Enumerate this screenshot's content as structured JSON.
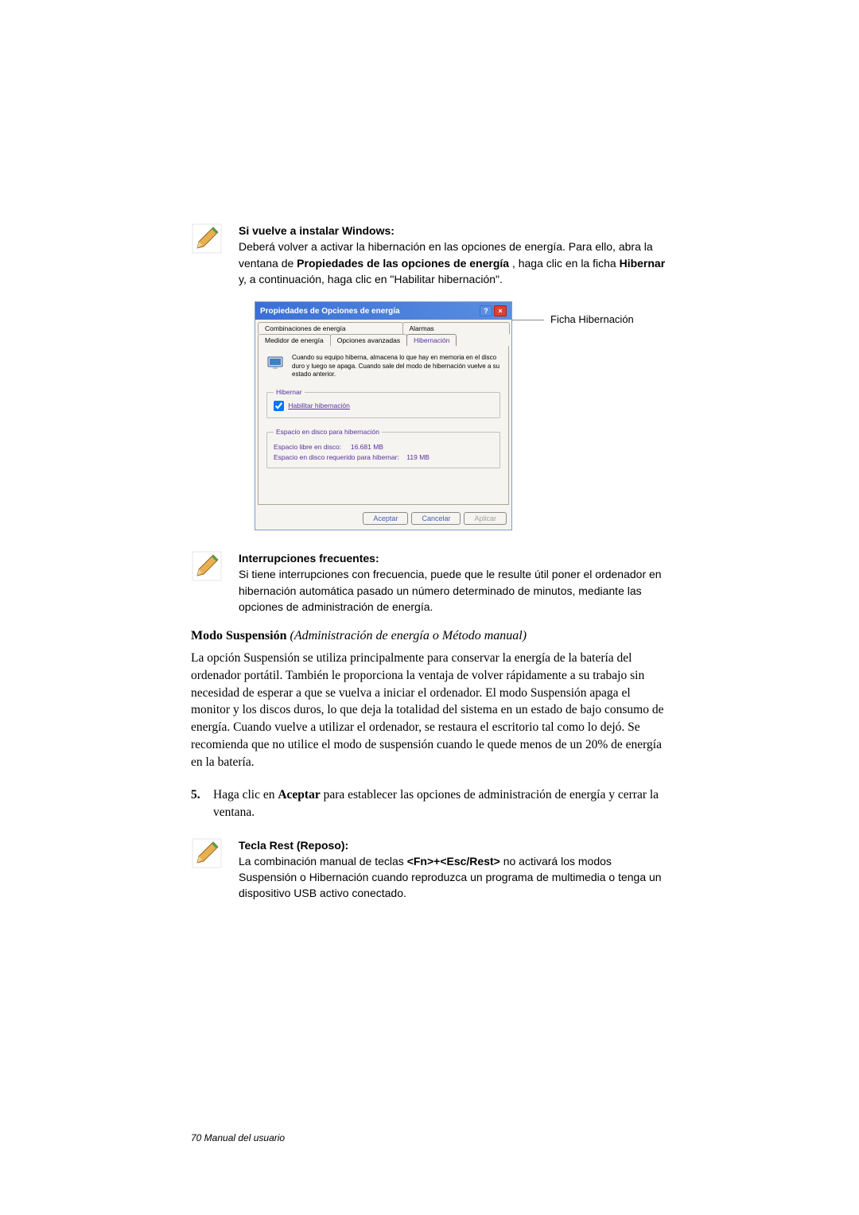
{
  "note1": {
    "title": "Si vuelve a instalar Windows:",
    "body1": "Deberá volver a activar la hibernación en las opciones de energía. Para ello, abra la ventana de ",
    "bold1": "Propiedades de las opciones de energía",
    "body2": " , haga clic en la ficha ",
    "bold2": "Hibernar",
    "body3": " y, a continuación, haga clic en \"Habilitar hibernación\"."
  },
  "dialog": {
    "title": "Propiedades de Opciones de energía",
    "tabs_row1": [
      "Combinaciones de energía",
      "Alarmas"
    ],
    "tabs_row2": [
      "Medidor de energía",
      "Opciones avanzadas",
      "Hibernación"
    ],
    "info_text": "Cuando su equipo hiberna, almacena lo que hay en memoria en el disco duro y luego se apaga. Cuando sale del modo de hibernación vuelve a su estado anterior.",
    "fieldset1_legend": "Hibernar",
    "checkbox_label": "Habilitar hibernación",
    "fieldset2_legend": "Espacio en disco para hibernación",
    "space_free_label": "Espacio libre en disco:",
    "space_free_value": "16.681 MB",
    "space_req_label": "Espacio en disco requerido para hibernar:",
    "space_req_value": "119 MB",
    "btn_accept": "Aceptar",
    "btn_cancel": "Cancelar",
    "btn_apply": "Aplicar"
  },
  "callout": "Ficha Hibernación",
  "note2": {
    "title": "Interrupciones frecuentes:",
    "body": "Si tiene interrupciones con frecuencia, puede que le resulte útil poner el ordenador en hibernación automática pasado un número determinado de minutos, mediante las opciones de administración de energía."
  },
  "section_heading": "Modo Suspensión",
  "section_heading_em": "(Administración de energía o Método manual)",
  "body_text": "La opción Suspensión se utiliza principalmente para conservar la energía de la batería del ordenador portátil. También le proporciona la ventaja de volver rápidamente a su trabajo sin necesidad de esperar a que se vuelva a iniciar el ordenador. El modo Suspensión apaga el monitor y los discos duros, lo que deja la totalidad del sistema en un estado de bajo consumo de energía. Cuando vuelve a utilizar el ordenador, se restaura el escritorio tal como lo dejó. Se recomienda que no utilice el modo de suspensión cuando le quede menos de un 20% de energía en la batería.",
  "step5_num": "5.",
  "step5a": "Haga clic en ",
  "step5b": "Aceptar",
  "step5c": " para establecer las opciones de administración de energía y cerrar la ventana.",
  "note3": {
    "title": "Tecla Rest (Reposo):",
    "body1": "La combinación manual de teclas ",
    "bold1": "<Fn>+<Esc/Rest>",
    "body2": " no activará los modos Suspensión o Hibernación cuando reproduzca un programa de multimedia o tenga un dispositivo USB activo conectado."
  },
  "footer": "70  Manual del usuario"
}
